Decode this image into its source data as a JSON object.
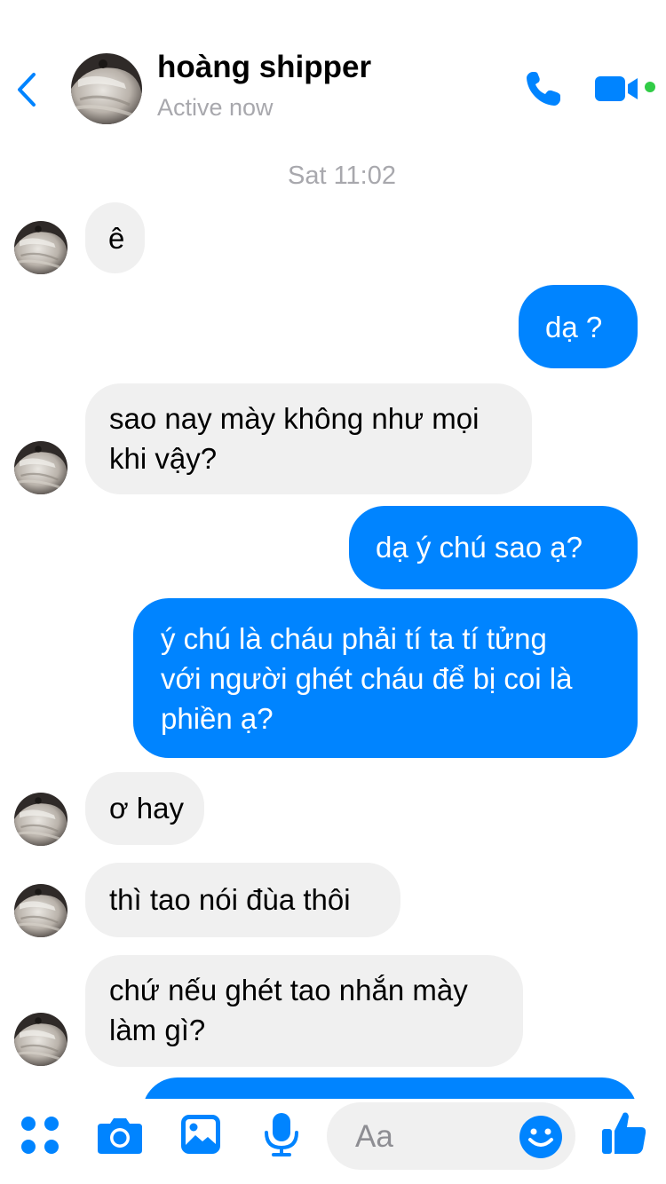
{
  "header": {
    "contact_name": "hoàng shipper",
    "status": "Active now"
  },
  "conversation": {
    "timestamp": "Sat 11:02",
    "messages": [
      {
        "from": "them",
        "text": "ê"
      },
      {
        "from": "me",
        "text": "dạ ?"
      },
      {
        "from": "them",
        "lines": [
          "sao nay mày không như mọi",
          "khi vậy?"
        ]
      },
      {
        "from": "me",
        "text": "dạ ý chú sao ạ?"
      },
      {
        "from": "me",
        "lines": [
          "ý chú là cháu phải tí ta tí tửng",
          "với người ghét cháu để bị coi là",
          "phiền ạ?"
        ]
      },
      {
        "from": "them",
        "text": "ơ hay"
      },
      {
        "from": "them",
        "text": "thì tao nói đùa thôi"
      },
      {
        "from": "them",
        "lines": [
          "chứ nếu ghét tao nhắn mày",
          "làm gì?"
        ]
      }
    ]
  },
  "composer": {
    "placeholder": "Aa"
  },
  "icons": {
    "back": "chevron-left-icon",
    "call": "phone-icon",
    "video": "video-camera-icon",
    "apps": "four-dots-icon",
    "camera": "camera-icon",
    "gallery": "image-icon",
    "mic": "microphone-icon",
    "emoji": "smiley-icon",
    "like": "thumbs-up-icon"
  },
  "colors": {
    "accent": "#0084ff",
    "incoming_bubble": "#f0f0f0",
    "online": "#31cc46",
    "muted_text": "#a8a8ad"
  }
}
